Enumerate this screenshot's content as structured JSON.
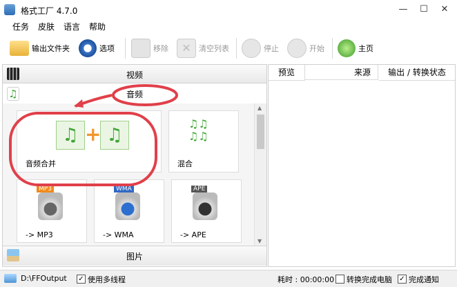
{
  "window": {
    "title": "格式工厂 4.7.0",
    "minimize": "—",
    "maximize": "☐",
    "close": "✕"
  },
  "menu": [
    "任务",
    "皮肤",
    "语言",
    "帮助"
  ],
  "toolbar": {
    "output_folder": "输出文件夹",
    "options": "选项",
    "remove": "移除",
    "clear_list": "清空列表",
    "stop": "停止",
    "start": "开始",
    "home": "主页"
  },
  "categories": {
    "video": "视频",
    "audio": "音频",
    "picture": "图片"
  },
  "tiles": [
    "音频合并",
    "混合",
    "-> MP3",
    "-> WMA",
    "-> APE"
  ],
  "tile_badges": {
    "mp3": "MP3",
    "wma": "WMA",
    "ape": "APE"
  },
  "columns": {
    "preview": "预览",
    "source": "来源",
    "output_status": "输出 / 转换状态"
  },
  "status": {
    "output_path": "D:\\FFOutput",
    "multithread": "使用多线程",
    "elapsed": "耗时 : 00:00:00",
    "shutdown": "转换完成电脑",
    "notify": "完成通知",
    "check": "✓"
  },
  "colors": {
    "annotation": "#e0404a",
    "music_note": "#3fa535"
  }
}
